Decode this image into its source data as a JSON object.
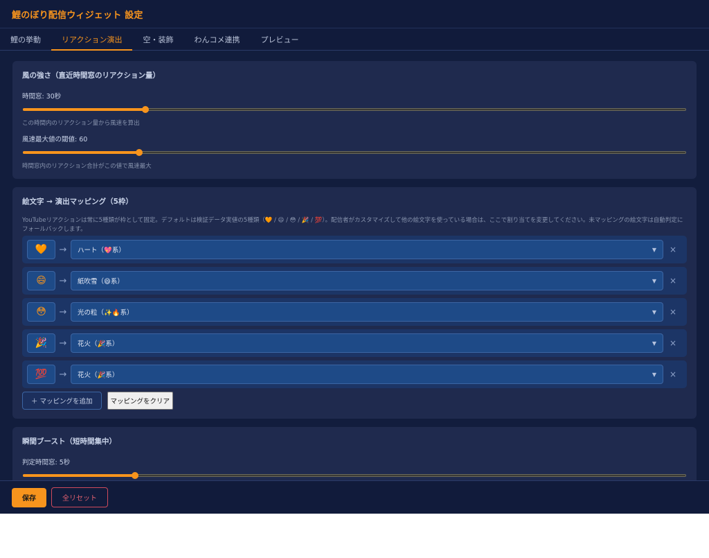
{
  "app": {
    "title": "鯉のぼり配信ウィジェット 設定"
  },
  "tabs": [
    {
      "label": "鯉の挙動",
      "active": false
    },
    {
      "label": "リアクション演出",
      "active": true
    },
    {
      "label": "空・装飾",
      "active": false
    },
    {
      "label": "わんコメ連携",
      "active": false
    },
    {
      "label": "プレビュー",
      "active": false
    }
  ],
  "wind": {
    "title": "風の強さ（直近時間窓のリアクション量）",
    "window_label": "時間窓: 30秒",
    "window_fraction": 0.185,
    "window_hint": "この時間内のリアクション量から風速を算出",
    "threshold_label": "風速最大値の閾値: 60",
    "threshold_fraction": 0.175,
    "threshold_hint": "時間窓内のリアクション合計がこの値で風速最大"
  },
  "mapping": {
    "title": "絵文字 → 演出マッピング（5枠）",
    "description": "YouTubeリアクションは常に5種類が枠として固定。デフォルトは検証データ実値の5種類（🧡 / 😄 / 😳 / 🎉 / 💯）。配信者がカスタマイズして他の絵文字を使っている場合は、ここで割り当てを変更してください。未マッピングの絵文字は自動判定にフォールバックします。",
    "arrow": "→",
    "remove": "×",
    "rows": [
      {
        "emoji": "🧡",
        "effect": "ハート（💖系）"
      },
      {
        "emoji": "😄",
        "effect": "紙吹雪（😄系）"
      },
      {
        "emoji": "😳",
        "effect": "光の粒（✨🔥系）"
      },
      {
        "emoji": "🎉",
        "effect": "花火（🎉系）"
      },
      {
        "emoji": "💯",
        "effect": "花火（🎉系）"
      }
    ],
    "add_label": "＋ マッピングを追加",
    "clear_label": "マッピングをクリア"
  },
  "boost": {
    "title": "瞬間ブースト（短時間集中）",
    "window_label": "判定時間窓: 5秒",
    "window_fraction": 0.169
  },
  "footer": {
    "save_label": "保存",
    "reset_label": "全リセット"
  },
  "colors": {
    "accent": "#f7941d",
    "background": "#121d3d",
    "card": "#1f2a4e",
    "danger": "#e0606f"
  }
}
